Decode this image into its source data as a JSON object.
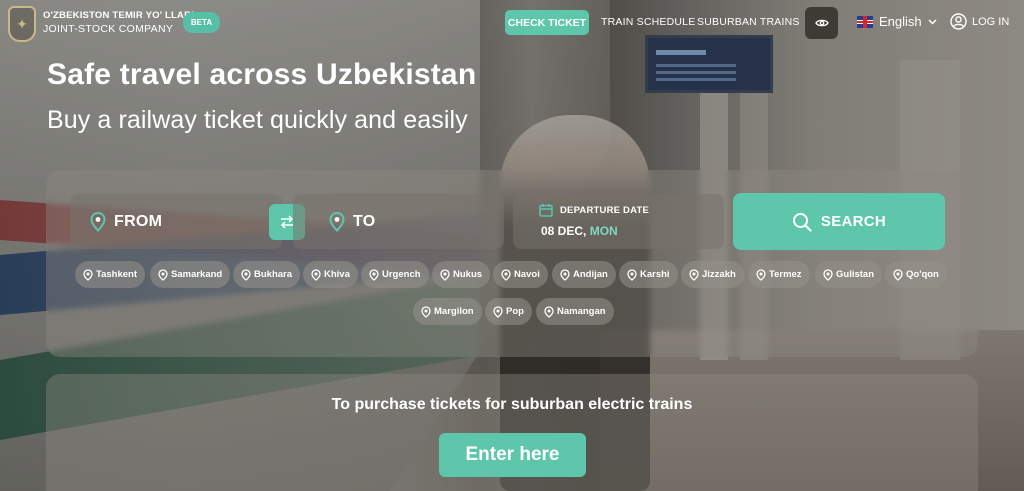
{
  "header": {
    "logo_line1": "O'ZBEKISTON TEMIR YO' LLARI",
    "logo_line2": "JOINT-STOCK COMPANY",
    "beta_badge": "BETA",
    "nav": {
      "check_ticket": "CHECK TICKET",
      "train_schedule": "TRAIN SCHEDULE",
      "suburban_trains": "SUBURBAN TRAINS"
    },
    "language": "English",
    "login": "LOG IN"
  },
  "hero": {
    "title": "Safe travel across Uzbekistan",
    "subtitle": "Buy a railway ticket quickly and easily"
  },
  "search": {
    "from_label": "FROM",
    "to_label": "TO",
    "date_label": "DEPARTURE DATE",
    "date_value": "08 DEC,",
    "date_day": "MON",
    "search_button": "SEARCH"
  },
  "cities": {
    "row1": [
      "Tashkent",
      "Samarkand",
      "Bukhara",
      "Khiva",
      "Urgench",
      "Nukus",
      "Navoi",
      "Andijan",
      "Karshi",
      "Jizzakh",
      "Termez",
      "Gulistan",
      "Qo'qon"
    ],
    "row2": [
      "Margilon",
      "Pop",
      "Namangan"
    ]
  },
  "suburban": {
    "text": "To purchase tickets for suburban electric trains",
    "button": "Enter here"
  },
  "colors": {
    "accent": "#5dc6ab",
    "accent_day_text": "#7fd8c0"
  },
  "icons": {
    "logo": "railway-emblem-icon",
    "eye": "eye-icon",
    "flag": "uk-flag-icon",
    "chevron": "chevron-down-icon",
    "user": "user-circle-icon",
    "pin": "location-pin-icon",
    "swap": "swap-arrows-icon",
    "calendar": "calendar-icon",
    "search": "search-icon"
  }
}
